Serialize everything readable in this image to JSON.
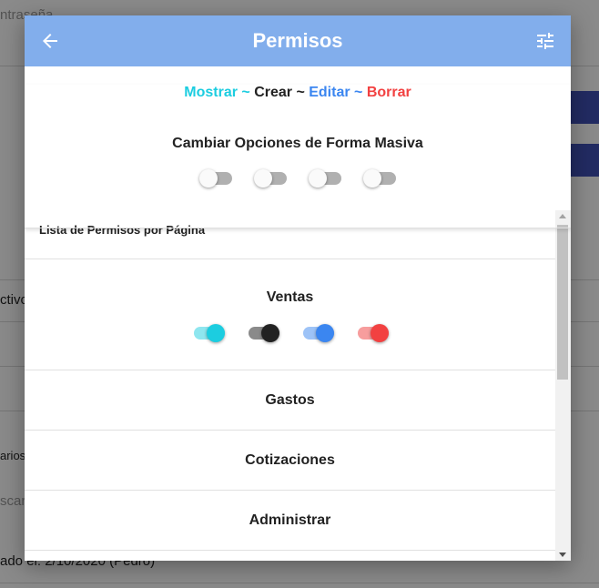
{
  "background": {
    "fragment_1": "ntraseña",
    "fragment_2": "ctivo",
    "fragment_3": "arios",
    "fragment_4": "scar",
    "fragment_5": "ado el: 2/10/2020 (Pedro)"
  },
  "dialog": {
    "title": "Permisos",
    "back_icon": "arrow-left-icon",
    "settings_icon": "tune-icon",
    "legend": {
      "show": "Mostrar",
      "sep1": " ~ ",
      "create": "Crear",
      "sep2": " ~ ",
      "edit": "Editar",
      "sep3": " ~ ",
      "delete": "Borrar"
    },
    "bulk_title": "Cambiar Opciones de Forma Masiva",
    "bulk_switches": [
      false,
      false,
      false,
      false
    ],
    "list_title": "Lista de Permisos por Página",
    "pages": [
      {
        "name": "Ventas",
        "switches": [
          true,
          true,
          true,
          true
        ]
      },
      {
        "name": "Gastos"
      },
      {
        "name": "Cotizaciones"
      },
      {
        "name": "Administrar"
      }
    ]
  },
  "colors": {
    "header": "#82aeec",
    "show": "#1ccde0",
    "create": "#222222",
    "edit": "#3b86f0",
    "delete": "#f24141"
  }
}
